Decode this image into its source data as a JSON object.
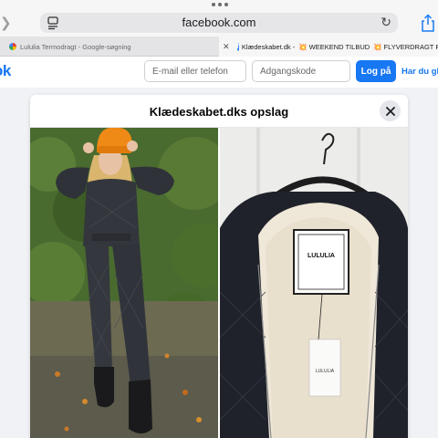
{
  "browser": {
    "url": "facebook.com",
    "tabs": [
      {
        "title": "Lululia Termodragt - Google-søgning"
      },
      {
        "title": "Klædeskabet.dk - ",
        "extra1": "WEEKEND TILBUD",
        "extra2": "FLYVERDRAGT PÅ"
      }
    ]
  },
  "fb_header": {
    "logo": "ok",
    "email_placeholder": "E-mail eller telefon",
    "password_placeholder": "Adgangskode",
    "login_label": "Log på",
    "forgot_label": "Har du glemt"
  },
  "modal": {
    "title": "Klædeskabet.dks opslag",
    "label_brand": "LULULIA"
  },
  "colors": {
    "accent": "#1877f2",
    "beanie": "#f08a16"
  }
}
